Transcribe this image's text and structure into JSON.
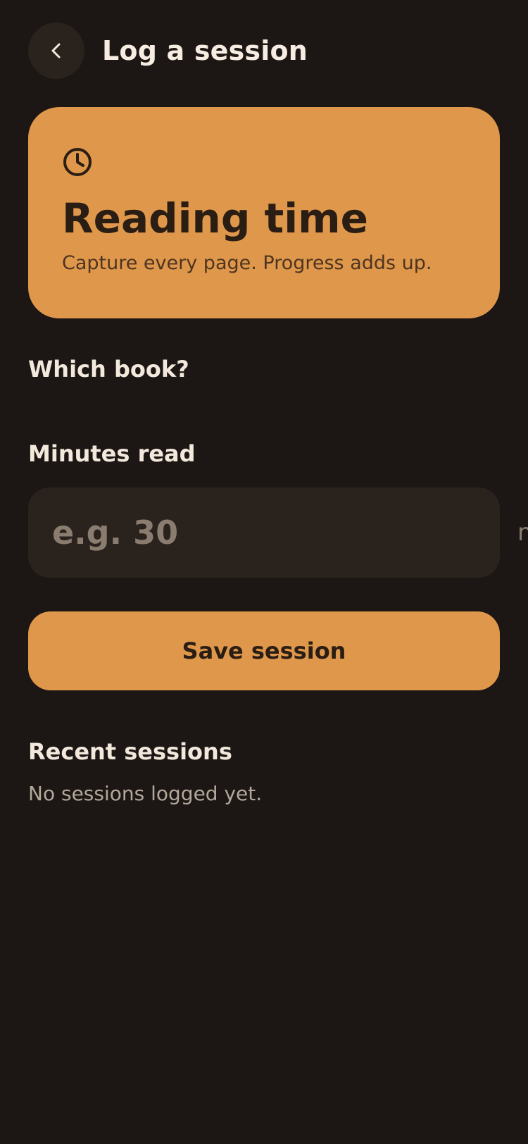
{
  "header": {
    "back_icon": "chevron-left-icon",
    "title": "Log a session"
  },
  "hero": {
    "icon": "clock-icon",
    "title": "Reading time",
    "subtitle": "Capture every page. Progress adds up."
  },
  "form": {
    "book_label": "Which book?",
    "minutes_label": "Minutes read",
    "minutes_placeholder": "e.g. 30",
    "minutes_value": "",
    "minutes_unit": "min",
    "save_label": "Save session"
  },
  "recent": {
    "title": "Recent sessions",
    "empty_text": "No sessions logged yet."
  },
  "colors": {
    "background": "#1c1714",
    "accent": "#df984b",
    "surface": "#2a221d",
    "text": "#f3e8dc",
    "muted": "#8a7d70"
  }
}
